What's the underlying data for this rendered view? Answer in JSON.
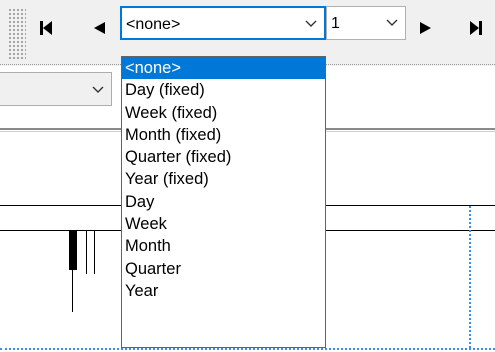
{
  "toolbar": {
    "period_combo": {
      "value": "<none>"
    },
    "count_combo": {
      "value": "1"
    }
  },
  "icons": {
    "first": "skip-to-first-icon",
    "prev": "previous-icon",
    "next": "next-icon",
    "last": "skip-to-last-icon",
    "dropdown_arrow": "chevron-down-icon"
  },
  "colors": {
    "accent": "#0078d7",
    "selection_text": "#ffffff",
    "grid_dashed": "#3a8ee6"
  },
  "dropdown": {
    "selected_index": 0,
    "items": [
      "<none>",
      "Day (fixed)",
      "Week (fixed)",
      "Month (fixed)",
      "Quarter (fixed)",
      "Year (fixed)",
      "Day",
      "Week",
      "Month",
      "Quarter",
      "Year"
    ]
  }
}
